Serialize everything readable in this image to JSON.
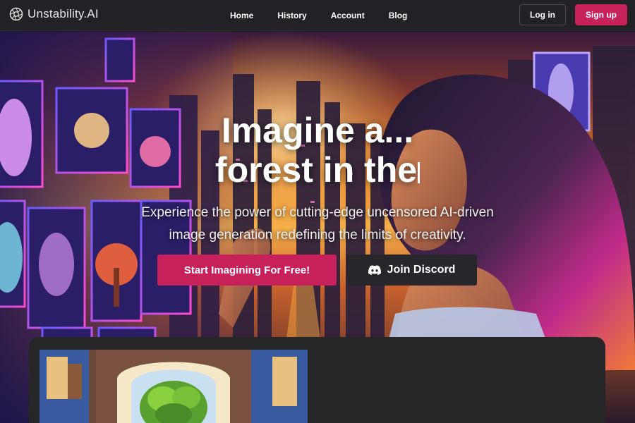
{
  "brand": {
    "name": "Unstability.AI",
    "logo_icon": "aperture-logo-icon"
  },
  "nav": {
    "links": [
      "Home",
      "History",
      "Account",
      "Blog"
    ],
    "login_label": "Log in",
    "signup_label": "Sign up"
  },
  "hero": {
    "title_line1": "Imagine a...",
    "title_line2": "forest in the",
    "subtitle_line1": "Experience the power of cutting-edge uncensored AI-driven",
    "subtitle_line2": "image generation redefining the limits of creativity.",
    "primary_cta": "Start Imagining For Free!",
    "discord_cta": "Join Discord",
    "discord_icon": "discord-icon"
  },
  "colors": {
    "accent": "#c6215a",
    "nav_bg": "#222226",
    "card_bg": "#262628",
    "discord_btn_bg": "#27272b"
  }
}
